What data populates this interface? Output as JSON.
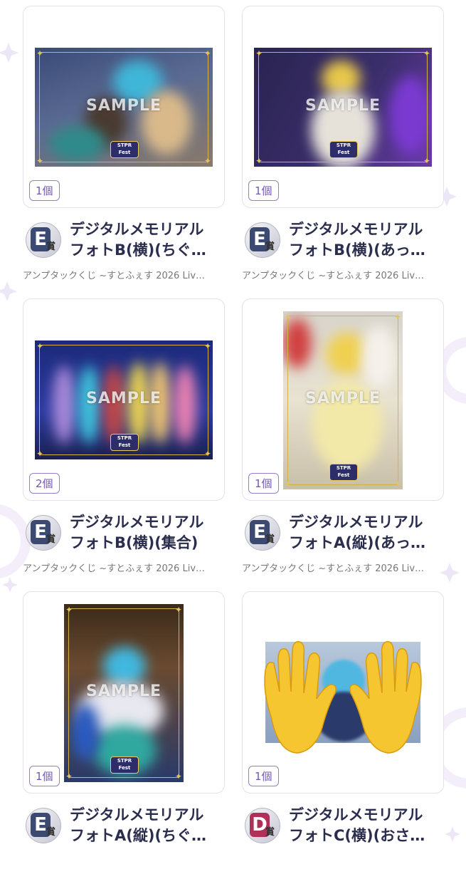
{
  "items": [
    {
      "qty": "1個",
      "grade": "E",
      "grade_suffix": "賞",
      "title": "デジタルメモリアル\nフォトB(横)(ちぐ…",
      "subtitle": "アンプタックくじ ~すとふぇす 2026 Liv…",
      "sample": "SAMPLE",
      "orientation": "landscape",
      "logo_text": "STPR Family Festival"
    },
    {
      "qty": "1個",
      "grade": "E",
      "grade_suffix": "賞",
      "title": "デジタルメモリアル\nフォトB(横)(あっ…",
      "subtitle": "アンプタックくじ ~すとふぇす 2026 Liv…",
      "sample": "SAMPLE",
      "orientation": "landscape",
      "logo_text": "STPR Family Festival"
    },
    {
      "qty": "2個",
      "grade": "E",
      "grade_suffix": "賞",
      "title": "デジタルメモリアル\nフォトB(横)(集合)",
      "subtitle": "アンプタックくじ ~すとふぇす 2026 Liv…",
      "sample": "SAMPLE",
      "orientation": "landscape",
      "logo_text": "STPR Family Festival"
    },
    {
      "qty": "1個",
      "grade": "E",
      "grade_suffix": "賞",
      "title": "デジタルメモリアル\nフォトA(縦)(あっ…",
      "subtitle": "アンプタックくじ ~すとふぇす 2026 Liv…",
      "sample": "SAMPLE",
      "orientation": "portrait",
      "logo_text": "STPR Family Festival"
    },
    {
      "qty": "1個",
      "grade": "E",
      "grade_suffix": "賞",
      "title": "デジタルメモリアル\nフォトA(縦)(ちぐ…",
      "subtitle": "",
      "sample": "SAMPLE",
      "orientation": "portrait",
      "logo_text": "STPR Family Festival"
    },
    {
      "qty": "1個",
      "grade": "D",
      "grade_suffix": "賞",
      "title": "デジタルメモリアル\nフォトC(横)(おさ…",
      "subtitle": "",
      "sample": "",
      "orientation": "landscape-covered",
      "logo_text": ""
    }
  ],
  "colors": {
    "grade_E": "#3c4a72",
    "grade_D": "#b0305a",
    "accent": "#7457b0",
    "title": "#2a2d4d"
  }
}
